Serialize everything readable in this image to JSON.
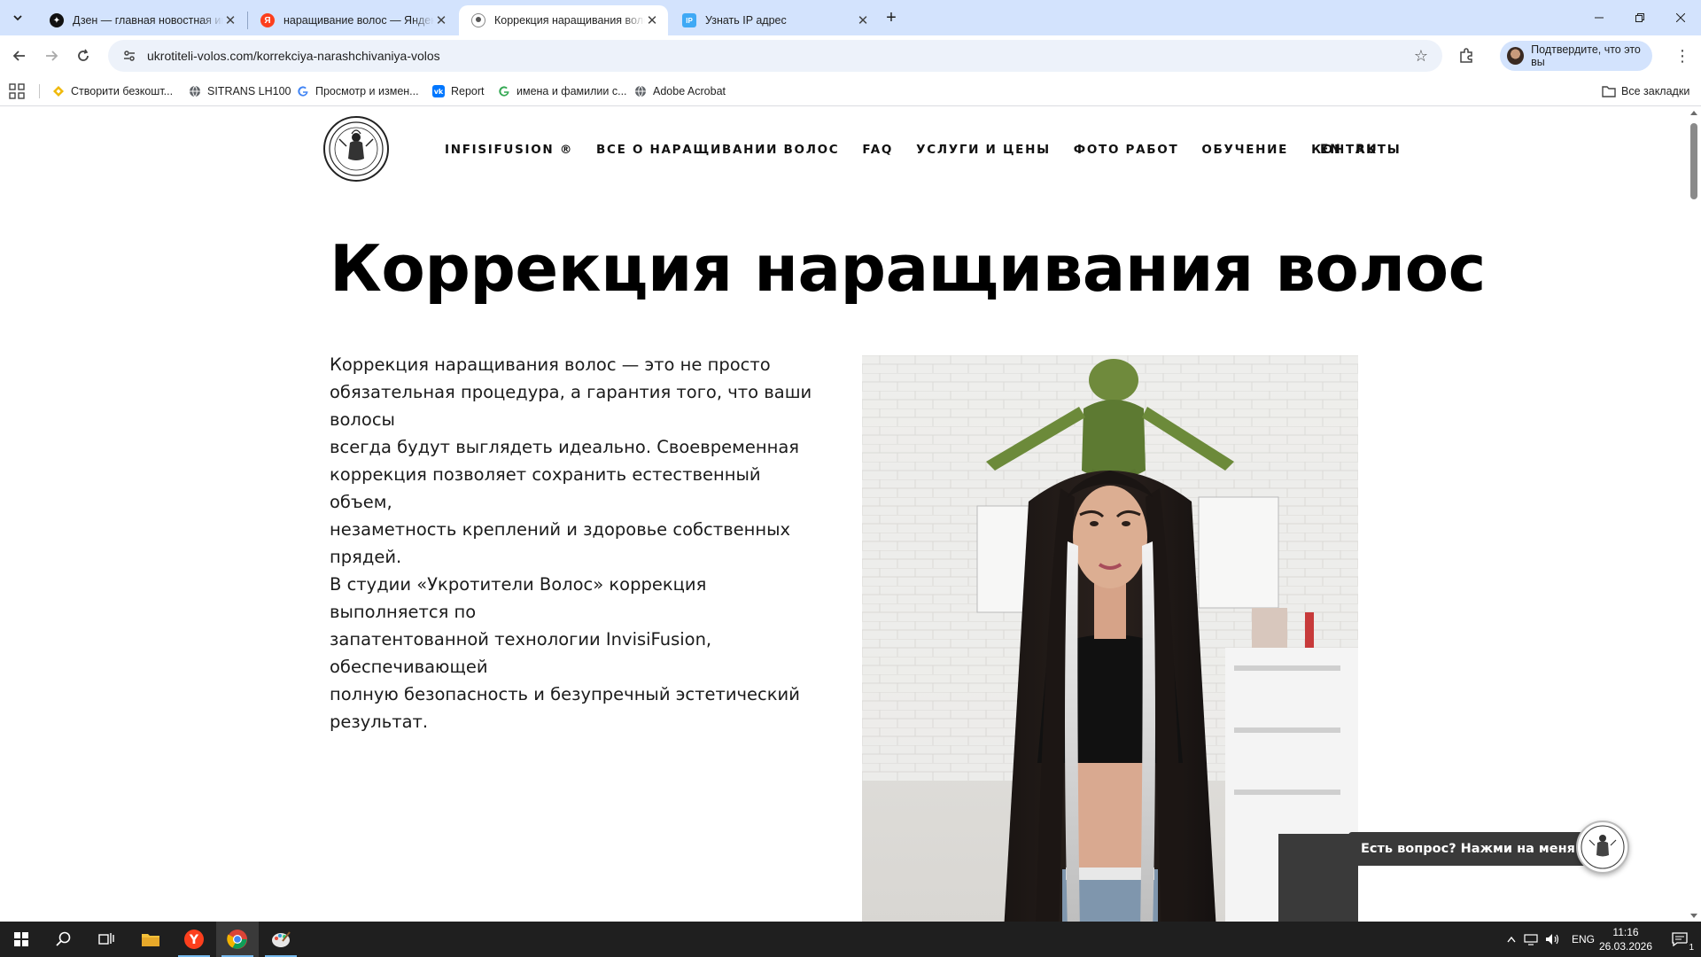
{
  "browser": {
    "tabs": [
      {
        "title": "Дзен — главная новостная ин",
        "favicon": "dzen-icon",
        "active": false
      },
      {
        "title": "наращивание волос — Яндекс",
        "favicon": "yandex-icon",
        "active": false
      },
      {
        "title": "Коррекция наращивания воло",
        "favicon": "site-favicon",
        "active": true
      },
      {
        "title": "Узнать IP адрес",
        "favicon": "ip-icon",
        "active": false
      }
    ],
    "url": "ukrotiteli-volos.com/korrekciya-narashchivaniya-volos",
    "profile_label": "Подтвердите, что это вы",
    "bookmarks": [
      {
        "label": "Створити безкошт...",
        "icon": "binance-icon"
      },
      {
        "label": "SITRANS LH100",
        "icon": "globe-icon"
      },
      {
        "label": "Просмотр и измен...",
        "icon": "google-icon"
      },
      {
        "label": "Report",
        "icon": "vk-icon"
      },
      {
        "label": "имена и фамилии с...",
        "icon": "google-icon"
      },
      {
        "label": "Adobe Acrobat",
        "icon": "globe-icon"
      }
    ],
    "all_bookmarks_label": "Все закладки"
  },
  "site": {
    "nav": [
      "INFISIFUSION ®",
      "ВСЕ О НАРАЩИВАНИИ ВОЛОС",
      "FAQ",
      "УСЛУГИ И ЦЕНЫ",
      "ФОТО РАБОТ",
      "ОБУЧЕНИЕ",
      "КОНТАКТЫ"
    ],
    "lang_en": "EN",
    "lang_ru": "RU",
    "title": "Коррекция наращивания волос",
    "intro_lines": [
      "Коррекция наращивания волос — это не просто",
      "обязательная процедура, а гарантия того, что ваши волосы",
      "всегда будут выглядеть идеально. Своевременная",
      "коррекция позволяет сохранить естественный объем,",
      "незаметность креплений и здоровье собственных прядей.",
      "В студии «Укротители Волос» коррекция выполняется по",
      "запатентованной технологии InvisiFusion, обеспечивающей",
      "полную безопасность и безупречный эстетический",
      "результат."
    ],
    "chat_prompt": "Есть вопрос? Нажми на меня!"
  },
  "taskbar": {
    "language": "ENG",
    "time": "11:16",
    "date": "26.03.2026",
    "notifications": "1"
  }
}
